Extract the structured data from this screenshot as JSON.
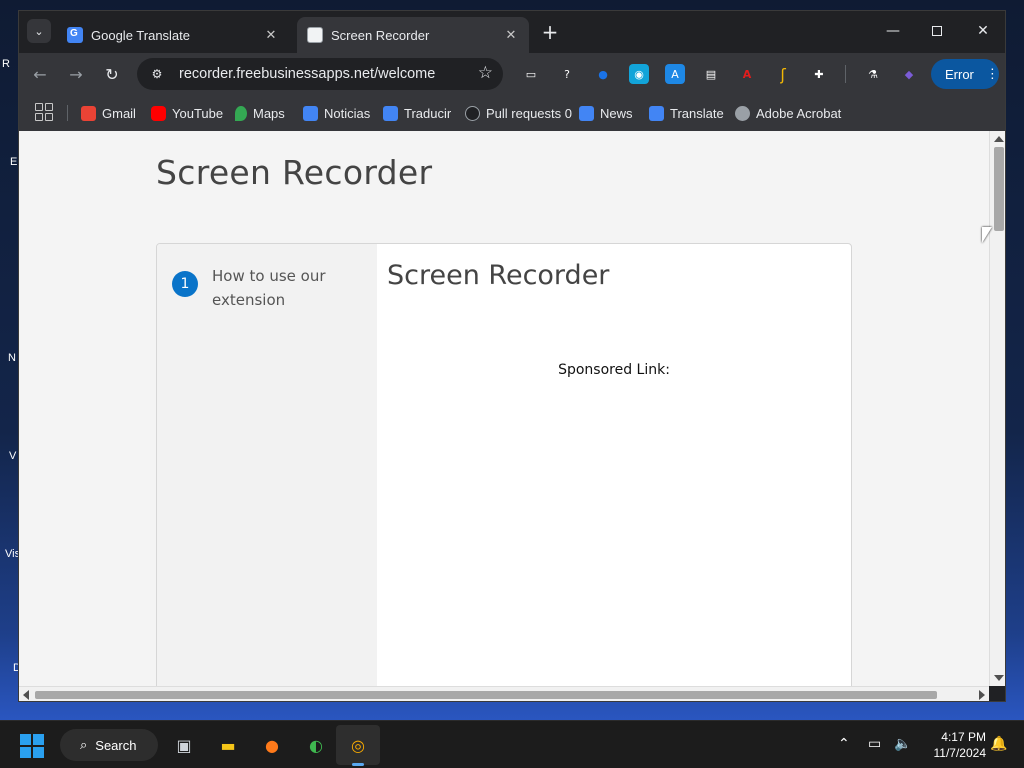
{
  "desktop": {
    "icon_labels": [
      "R",
      "E",
      "N",
      "V",
      "Vis",
      "D"
    ]
  },
  "browser": {
    "tabs": [
      {
        "title": "Google Translate",
        "active": false,
        "favicon": "google-translate-icon"
      },
      {
        "title": "Screen Recorder",
        "active": true,
        "favicon": "document-icon"
      }
    ],
    "url": "recorder.freebusinessapps.net/welcome",
    "profile_button": "Error",
    "bookmarks": [
      {
        "label": "Gmail",
        "icon": "gmail-icon",
        "color": "#ea4335"
      },
      {
        "label": "YouTube",
        "icon": "youtube-icon",
        "color": "#ff0000"
      },
      {
        "label": "Maps",
        "icon": "maps-icon",
        "color": "#34a853"
      },
      {
        "label": "Noticias",
        "icon": "google-translate-icon",
        "color": "#4285f4"
      },
      {
        "label": "Traducir",
        "icon": "google-translate-icon",
        "color": "#4285f4"
      },
      {
        "label": "Pull requests 0",
        "icon": "github-icon",
        "color": "#202124"
      },
      {
        "label": "News",
        "icon": "google-translate-icon",
        "color": "#4285f4"
      },
      {
        "label": "Translate",
        "icon": "google-translate-icon",
        "color": "#4285f4"
      },
      {
        "label": "Adobe Acrobat",
        "icon": "globe-icon",
        "color": "#9aa0a6"
      }
    ],
    "extensions": [
      {
        "name": "tab-manager-icon",
        "color": "#e8eaed",
        "glyph": "▭"
      },
      {
        "name": "help-circle-icon",
        "color": "#e8eaed",
        "glyph": "?"
      },
      {
        "name": "screen-recorder-icon",
        "color": "#1a73e8",
        "glyph": "●"
      },
      {
        "name": "camera-icon",
        "color": "#12a4d9",
        "glyph": "◉"
      },
      {
        "name": "translate-ext-icon",
        "color": "#1e88e5",
        "glyph": "A"
      },
      {
        "name": "printer-icon",
        "color": "#e8eaed",
        "glyph": "▤"
      },
      {
        "name": "acrobat-icon",
        "color": "#e11d1d",
        "glyph": "A"
      },
      {
        "name": "brush-icon",
        "color": "#f2b705",
        "glyph": "ʃ"
      },
      {
        "name": "puzzle-icon",
        "color": "#e8eaed",
        "glyph": "✚"
      },
      {
        "name": "flask-icon",
        "color": "#e8eaed",
        "glyph": "⚗"
      },
      {
        "name": "profile-avatar-icon",
        "color": "#5b3fa8",
        "glyph": "◆"
      }
    ]
  },
  "page": {
    "title": "Screen Recorder",
    "step": {
      "number": "1",
      "label": "How to use our extension"
    },
    "card_title": "Screen Recorder",
    "sponsored": "Sponsored Link:"
  },
  "taskbar": {
    "search_label": "Search",
    "time": "4:17 PM",
    "date": "11/7/2024",
    "colors": {
      "start": "#2aa0f0",
      "active_indicator": "#5aa8f0"
    }
  }
}
